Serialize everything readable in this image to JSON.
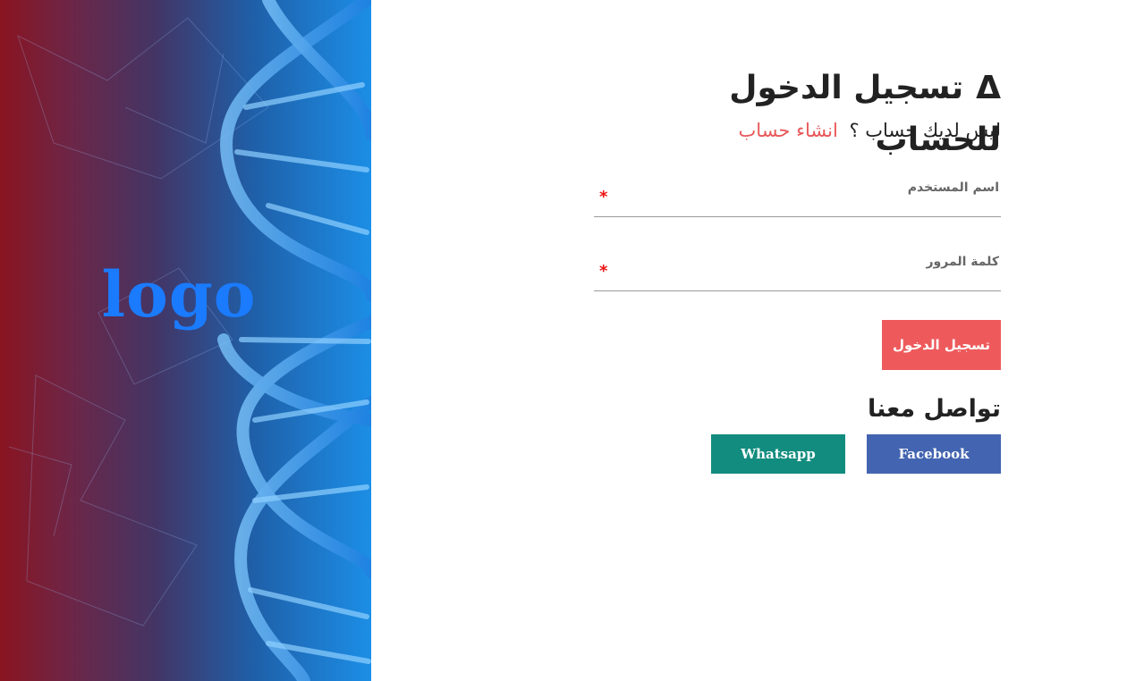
{
  "hero": {
    "logo_text": "logo"
  },
  "form": {
    "title_icon": "Δ",
    "title": "تسجيل الدخول للحساب",
    "subtitle_prefix": "ليس لديك حساب ؟",
    "create_account_link": "انشاء حساب",
    "username_label": "اسم المستخدم",
    "password_label": "كلمة المرور",
    "required_marker": "*",
    "login_button": "تسجيل الدخول"
  },
  "contact": {
    "title": "تواصل معنا",
    "facebook_label": "Facebook",
    "whatsapp_label": "Whatsapp"
  },
  "colors": {
    "accent_red": "#ee5a5c",
    "facebook_blue": "#4364b0",
    "whatsapp_green": "#128c7e",
    "logo_blue": "#1a7bff"
  }
}
